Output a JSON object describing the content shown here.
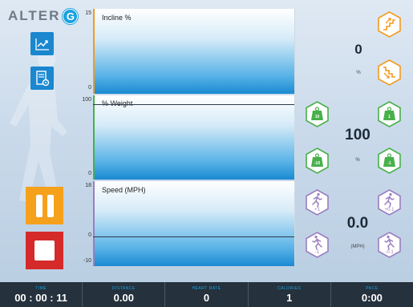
{
  "brand": {
    "name": "ALTER",
    "mark": "G"
  },
  "left_buttons": {
    "chart_icon": "line-chart-icon",
    "document_icon": "document-settings-icon",
    "pause_icon": "pause-icon",
    "stop_icon": "stop-icon"
  },
  "charts": {
    "incline": {
      "title": "Incline %",
      "y_max": "15",
      "y_min": "0",
      "current_value": 0,
      "line_color": "#f39a1e"
    },
    "weight": {
      "title": "% Weight",
      "y_max": "100",
      "y_min": "0",
      "current_value": 100,
      "line_color": "#48b04a"
    },
    "speed": {
      "title": "Speed (MPH)",
      "y_max": "18",
      "y_zero": "0",
      "y_min": "-10",
      "current_value": 0,
      "line_color": "#9b7dc0"
    }
  },
  "incline_controls": {
    "value": "0",
    "unit": "%",
    "up_icon": "stairs-up-icon",
    "down_icon": "stairs-down-icon",
    "color": "#f39a1e"
  },
  "weight_controls": {
    "value": "100",
    "unit": "%",
    "plus_10_label": "10",
    "minus_10_label": "-10",
    "plus_1_label": "1",
    "minus_1_label": "-1",
    "icon": "weight-icon",
    "color": "#48b04a"
  },
  "speed_controls": {
    "value": "0.0",
    "unit": "(MPH)",
    "plus_1_label": "+1",
    "minus_1_label": "-1",
    "plus_01_label": "+0.1",
    "minus_01_label": "-0.1",
    "icon": "runner-icon",
    "color": "#9b7dc0"
  },
  "status_bar": {
    "time_label": "TIME",
    "time_value": "00 : 00 : 11",
    "distance_label": "DISTANCE",
    "distance_value": "0.00",
    "heart_rate_label": "HEART RATE",
    "heart_rate_value": "0",
    "calories_label": "CALORIES",
    "calories_value": "1",
    "pace_label": "PACE",
    "pace_value": "0:00"
  }
}
